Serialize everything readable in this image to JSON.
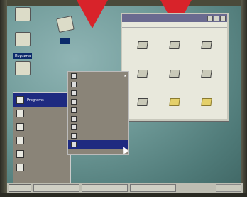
{
  "desktop": {
    "icons": [
      {
        "name": "my-computer-icon",
        "label": ""
      },
      {
        "name": "recycle-bin-icon",
        "label": "Корзина"
      },
      {
        "name": "network-icon",
        "label": ""
      },
      {
        "name": "shortcut-icon",
        "label": ""
      }
    ]
  },
  "window": {
    "title": "",
    "menu": "",
    "items": [
      "",
      "",
      "",
      "",
      "",
      "",
      "",
      "",
      ""
    ]
  },
  "start_menu": {
    "items": [
      {
        "label": "Programs",
        "selected": true
      },
      {
        "label": "",
        "selected": false
      },
      {
        "label": "",
        "selected": false
      },
      {
        "label": "",
        "selected": false
      },
      {
        "label": "",
        "selected": false
      },
      {
        "label": "",
        "selected": false
      }
    ]
  },
  "submenu": {
    "items": [
      "",
      "",
      "",
      "",
      "",
      "",
      "",
      "",
      ""
    ]
  },
  "taskbar": {
    "start_label": "",
    "buttons": [
      "",
      "",
      ""
    ],
    "tray": ""
  },
  "colors": {
    "accent": "#d8232a",
    "selection": "#1e2a80",
    "desktop": "#6f9a98"
  }
}
